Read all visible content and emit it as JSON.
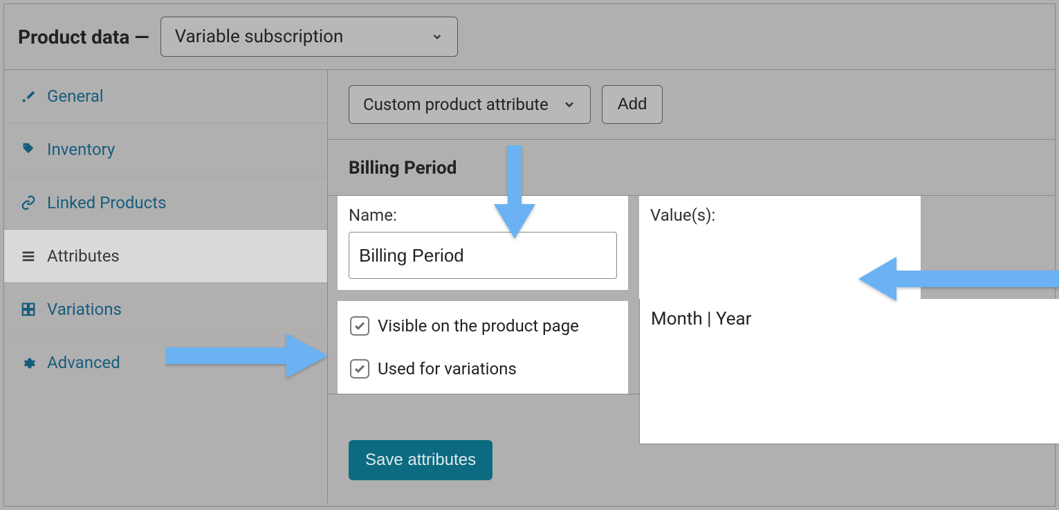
{
  "header": {
    "title": "Product data —",
    "product_type_selected": "Variable subscription"
  },
  "sidebar": {
    "tabs": [
      {
        "key": "general",
        "label": "General",
        "icon": "wrench-icon"
      },
      {
        "key": "inventory",
        "label": "Inventory",
        "icon": "tag-icon"
      },
      {
        "key": "linked",
        "label": "Linked Products",
        "icon": "link-icon"
      },
      {
        "key": "attributes",
        "label": "Attributes",
        "icon": "list-icon",
        "active": true
      },
      {
        "key": "variations",
        "label": "Variations",
        "icon": "grid-icon"
      },
      {
        "key": "advanced",
        "label": "Advanced",
        "icon": "gear-icon"
      }
    ]
  },
  "content": {
    "attribute_type_selected": "Custom product attribute",
    "add_label": "Add",
    "attribute_title": "Billing Period",
    "name_label": "Name:",
    "name_value": "Billing Period",
    "values_label": "Value(s):",
    "values_value": "Month | Year",
    "visible_label": "Visible on the product page",
    "visible_checked": true,
    "variations_label": "Used for variations",
    "variations_checked": true,
    "save_label": "Save attributes"
  },
  "overlay": {
    "dim_color": "#b0b0b0"
  }
}
